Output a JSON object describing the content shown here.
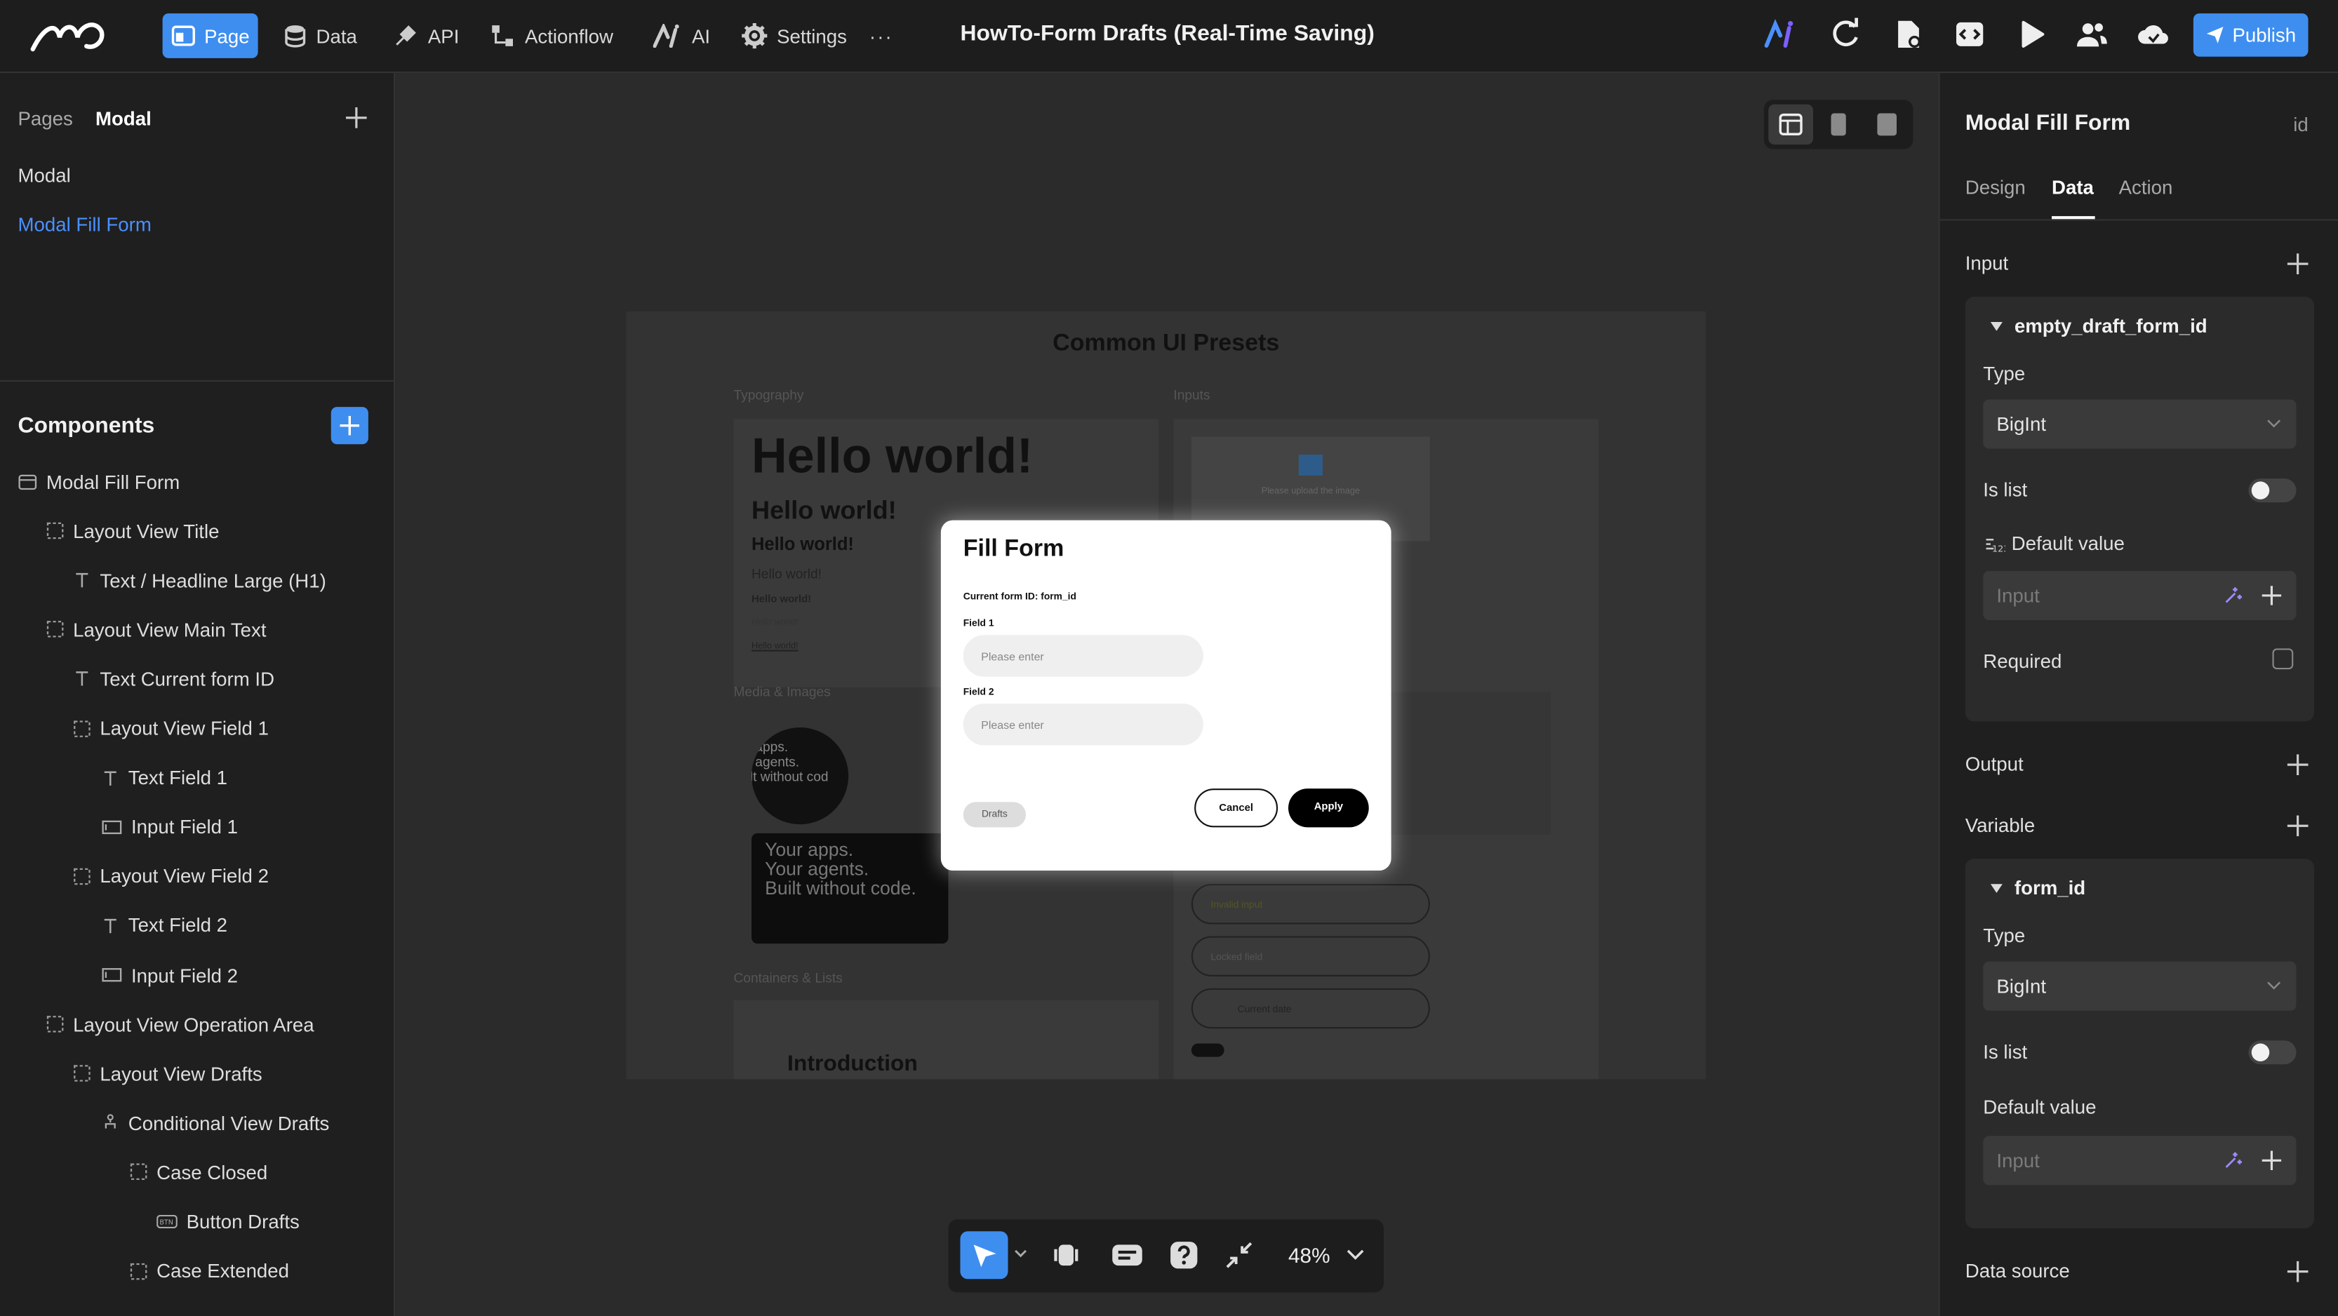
{
  "topbar": {
    "nav": [
      {
        "label": "Page",
        "icon": "page-icon",
        "active": true
      },
      {
        "label": "Data",
        "icon": "database-icon"
      },
      {
        "label": "API",
        "icon": "plug-icon"
      },
      {
        "label": "Actionflow",
        "icon": "flow-icon"
      },
      {
        "label": "AI",
        "icon": "ai-icon"
      },
      {
        "label": "Settings",
        "icon": "gear-icon"
      }
    ],
    "more": "···",
    "project_title": "HowTo-Form Drafts (Real-Time Saving)",
    "publish_label": "Publish"
  },
  "left_panel": {
    "tabs": [
      "Pages",
      "Modal"
    ],
    "pages": [
      "Modal",
      "Modal Fill Form"
    ],
    "components_title": "Components",
    "tree": [
      {
        "label": "Modal Fill Form",
        "icon": "modal-icon",
        "depth": 0
      },
      {
        "label": "Layout View Title",
        "icon": "layout-icon",
        "depth": 1
      },
      {
        "label": "Text / Headline Large (H1)",
        "icon": "text-icon",
        "depth": 2
      },
      {
        "label": "Layout View Main Text",
        "icon": "layout-icon",
        "depth": 1
      },
      {
        "label": "Text Current form ID",
        "icon": "text-icon",
        "depth": 2
      },
      {
        "label": "Layout View Field 1",
        "icon": "layout-icon",
        "depth": 2
      },
      {
        "label": "Text Field 1",
        "icon": "text-icon",
        "depth": 3
      },
      {
        "label": "Input Field 1",
        "icon": "input-icon",
        "depth": 3
      },
      {
        "label": "Layout View Field 2",
        "icon": "layout-icon",
        "depth": 2
      },
      {
        "label": "Text Field 2",
        "icon": "text-icon",
        "depth": 3
      },
      {
        "label": "Input Field 2",
        "icon": "input-icon",
        "depth": 3
      },
      {
        "label": "Layout View Operation Area",
        "icon": "layout-icon",
        "depth": 1
      },
      {
        "label": "Layout View Drafts",
        "icon": "layout-icon",
        "depth": 2
      },
      {
        "label": "Conditional View Drafts",
        "icon": "conditional-icon",
        "depth": 3
      },
      {
        "label": "Case Closed",
        "icon": "layout-icon",
        "depth": 4
      },
      {
        "label": "Button Drafts",
        "icon": "button-icon",
        "depth": 5
      },
      {
        "label": "Case Extended",
        "icon": "layout-icon",
        "depth": 4
      }
    ]
  },
  "canvas": {
    "page_title": "Common UI Presets",
    "typography_label": "Typography",
    "inputs_label": "Inputs",
    "hello": [
      "Hello world!",
      "Hello world!",
      "Hello world!",
      "Hello world!",
      "Hello world!",
      "Hello world!",
      "Hello world!"
    ],
    "media_label": "Media & Images",
    "promo_lines": [
      "Your apps.",
      "Your agents.",
      "Built without code."
    ],
    "containers_label": "Containers & Lists",
    "intro": "Introduction",
    "upload_text": "Please upload the image",
    "invalid_input": "Invalid input",
    "locked_field": "Locked field",
    "current_date": "Current date",
    "zoom": "48%"
  },
  "modal": {
    "title": "Fill Form",
    "current_form_id": "Current form ID: form_id",
    "field1_label": "Field 1",
    "field1_placeholder": "Please enter",
    "field2_label": "Field 2",
    "field2_placeholder": "Please enter",
    "drafts": "Drafts",
    "cancel": "Cancel",
    "apply": "Apply"
  },
  "right_panel": {
    "title": "Modal Fill Form",
    "id_label": "id",
    "tabs": [
      "Design",
      "Data",
      "Action"
    ],
    "active_tab": "Data",
    "input_section": "Input",
    "input_item": {
      "name": "empty_draft_form_id",
      "type_label": "Type",
      "type_value": "BigInt",
      "is_list": "Is list",
      "default_value": "Default value",
      "default_placeholder": "Input",
      "required": "Required"
    },
    "output_section": "Output",
    "variable_section": "Variable",
    "variable_item": {
      "name": "form_id",
      "type_label": "Type",
      "type_value": "BigInt",
      "is_list": "Is list",
      "default_value": "Default value",
      "default_placeholder": "Input"
    },
    "data_source_section": "Data source"
  },
  "colors": {
    "accent": "#3e8ef0",
    "panel": "#1f1f1f",
    "canvas": "#2b2b2b"
  }
}
